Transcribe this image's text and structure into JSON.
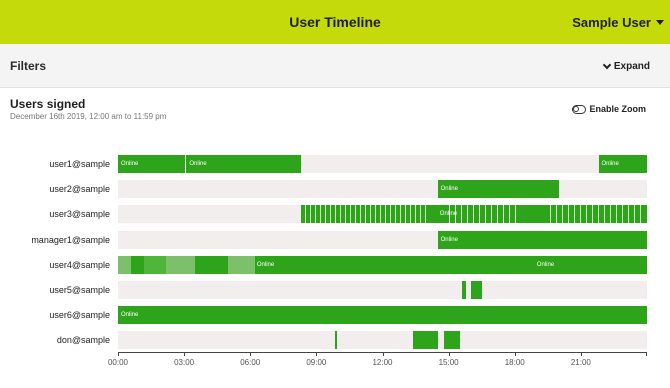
{
  "header": {
    "title": "User Timeline",
    "user_menu": "Sample User"
  },
  "filters": {
    "label": "Filters",
    "expand_label": "Expand"
  },
  "card": {
    "title": "Users signed",
    "subtitle": "December 16th 2019, 12:00 am to 11:59 pm",
    "zoom_label": "Enable Zoom"
  },
  "colors": {
    "online": "#2ea41a",
    "online_light": "#7cc06c",
    "track": "#f2eeee",
    "brand": "#c5da0a"
  },
  "chart_data": {
    "type": "timeline",
    "x_unit": "hours",
    "xlim": [
      0,
      24
    ],
    "x_ticks": [
      "00:00",
      "03:00",
      "06:00",
      "09:00",
      "12:00",
      "15:00",
      "18:00",
      "21:00"
    ],
    "rows": [
      {
        "user": "user1@sample",
        "segments": [
          {
            "start": 0.0,
            "end": 2.9,
            "label": "Online"
          },
          {
            "start": 2.9,
            "end": 3.05
          },
          {
            "start": 3.1,
            "end": 8.3,
            "label": "Online"
          },
          {
            "start": 21.8,
            "end": 24.0,
            "label": "Online"
          }
        ]
      },
      {
        "user": "user2@sample",
        "segments": [
          {
            "start": 14.5,
            "end": 20.0,
            "label": "Online"
          }
        ]
      },
      {
        "user": "user3@sample",
        "segments": [
          {
            "start": 8.3,
            "end": 24.0,
            "label": "Online",
            "striped": true
          }
        ]
      },
      {
        "user": "manager1@sample",
        "segments": [
          {
            "start": 14.5,
            "end": 24.0,
            "label": "Online"
          }
        ]
      },
      {
        "user": "user4@sample",
        "segments": [
          {
            "start": 0.0,
            "end": 0.6,
            "shade": "light"
          },
          {
            "start": 0.6,
            "end": 1.2
          },
          {
            "start": 1.2,
            "end": 2.2,
            "shade": "mid"
          },
          {
            "start": 2.2,
            "end": 3.5,
            "shade": "light"
          },
          {
            "start": 3.5,
            "end": 5.0
          },
          {
            "start": 5.0,
            "end": 6.2,
            "shade": "light"
          },
          {
            "start": 6.2,
            "end": 24.0,
            "label": "Online",
            "label2": "Online"
          }
        ]
      },
      {
        "user": "user5@sample",
        "segments": [
          {
            "start": 15.6,
            "end": 15.8
          },
          {
            "start": 16.0,
            "end": 16.5
          }
        ]
      },
      {
        "user": "user6@sample",
        "segments": [
          {
            "start": 0.0,
            "end": 24.0,
            "label": "Online"
          }
        ]
      },
      {
        "user": "don@sample",
        "segments": [
          {
            "start": 9.85,
            "end": 9.95
          },
          {
            "start": 13.4,
            "end": 14.5
          },
          {
            "start": 14.8,
            "end": 15.5
          }
        ]
      }
    ]
  }
}
